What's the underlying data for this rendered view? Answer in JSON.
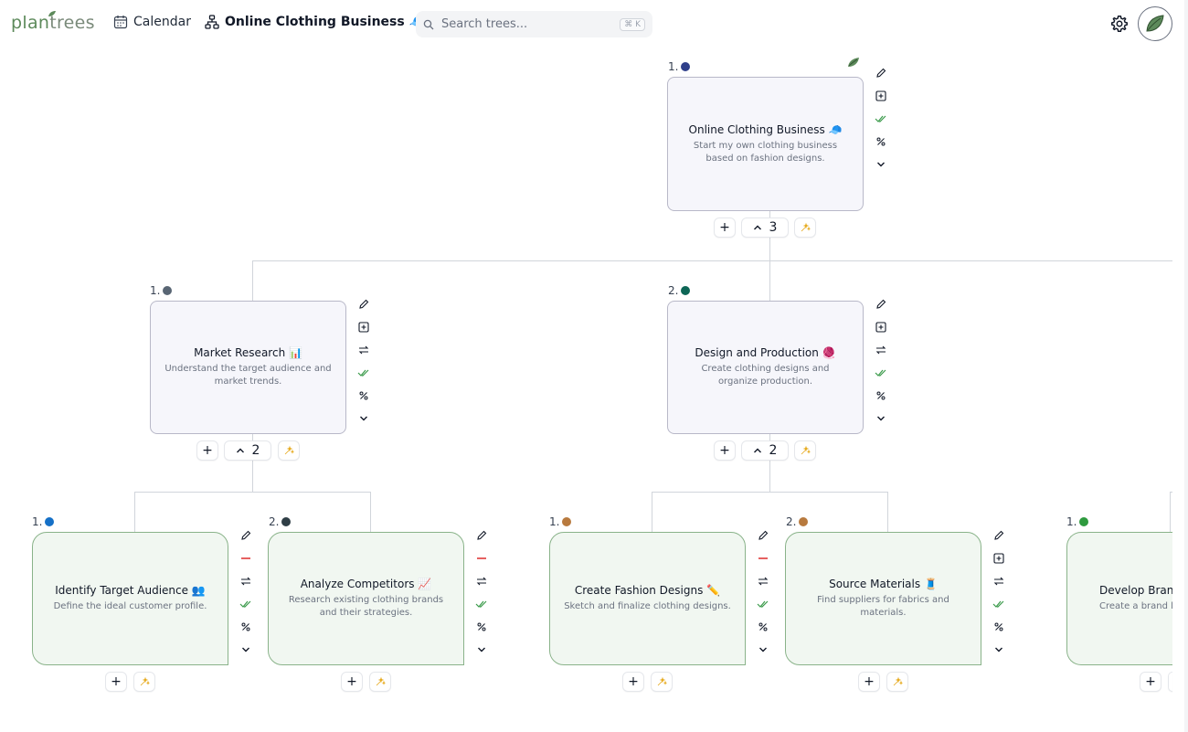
{
  "header": {
    "logo": {
      "part1": "plan",
      "part2": "trees"
    },
    "calendar_label": "Calendar",
    "tree_title": "Online Clothing Business 🧢",
    "search_placeholder": "Search trees...",
    "search_shortcut": "⌘ K"
  },
  "colors": {
    "accent_green": "#5d8a5b",
    "card_border": "#b8b8c8",
    "leaf_border": "#8ab38a"
  },
  "root": {
    "number": "1.",
    "dot_color": "#2f3f8a",
    "title": "Online Clothing Business 🧢",
    "desc": "Start my own clothing business based on fashion designs.",
    "child_count": "3"
  },
  "level1": [
    {
      "number": "1.",
      "dot_color": "#596674",
      "title": "Market Research 📊",
      "desc": "Understand the target audience and market trends.",
      "child_count": "2"
    },
    {
      "number": "2.",
      "dot_color": "#0d6656",
      "title": "Design and Production 🧶",
      "desc": "Create clothing designs and organize production.",
      "child_count": "2"
    }
  ],
  "level2": [
    {
      "number": "1.",
      "dot_color": "#1570c7",
      "title": "Identify Target Audience 👥",
      "desc": "Define the ideal customer profile."
    },
    {
      "number": "2.",
      "dot_color": "#2f3e46",
      "title": "Analyze Competitors 📈",
      "desc": "Research existing clothing brands and their strategies."
    },
    {
      "number": "1.",
      "dot_color": "#b87a3e",
      "title": "Create Fashion Designs ✏️",
      "desc": "Sketch and finalize clothing designs."
    },
    {
      "number": "2.",
      "dot_color": "#b87a3e",
      "title": "Source Materials 🧵",
      "desc": "Find suppliers for fabrics and materials."
    },
    {
      "number": "1.",
      "dot_color": "#2e9a3e",
      "title": "Develop Brand",
      "desc": "Create a brand lo"
    }
  ],
  "icons": {
    "edit": "pencil-icon",
    "add_child": "plus-square-icon",
    "remove": "minus-icon",
    "move": "swap-icon",
    "complete": "double-check-icon",
    "progress": "percent-icon",
    "expand": "chevron-down-icon",
    "ai": "sparkle-icon"
  }
}
